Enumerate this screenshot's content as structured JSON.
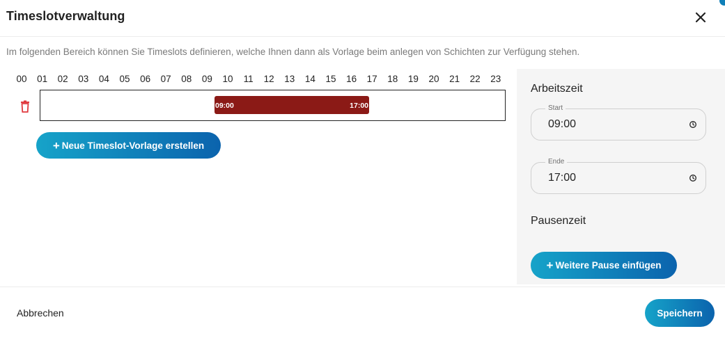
{
  "dialog": {
    "title": "Timeslotverwaltung",
    "description": "Im folgenden Bereich können Sie Timeslots definieren, welche Ihnen dann als Vorlage beim anlegen von Schichten zur Verfügung stehen."
  },
  "timeline": {
    "hours": [
      "00",
      "01",
      "02",
      "03",
      "04",
      "05",
      "06",
      "07",
      "08",
      "09",
      "10",
      "11",
      "12",
      "13",
      "14",
      "15",
      "16",
      "17",
      "18",
      "19",
      "20",
      "21",
      "22",
      "23"
    ],
    "timeslot": {
      "start": "09:00",
      "end": "17:00",
      "color": "#8b1a16"
    },
    "new_template_label": "Neue Timeslot-Vorlage erstellen"
  },
  "sidepanel": {
    "working_time_title": "Arbeitszeit",
    "start_label": "Start",
    "start_value": "09:00",
    "end_label": "Ende",
    "end_value": "17:00",
    "break_title": "Pausenzeit",
    "add_break_label": "Weitere Pause einfügen"
  },
  "footer": {
    "cancel_label": "Abbrechen",
    "save_label": "Speichern"
  },
  "colors": {
    "accent_gradient_start": "#16a3c9",
    "accent_gradient_end": "#0b63ad",
    "delete_icon": "#e0393e",
    "timeslot_bar": "#8b1a16"
  }
}
